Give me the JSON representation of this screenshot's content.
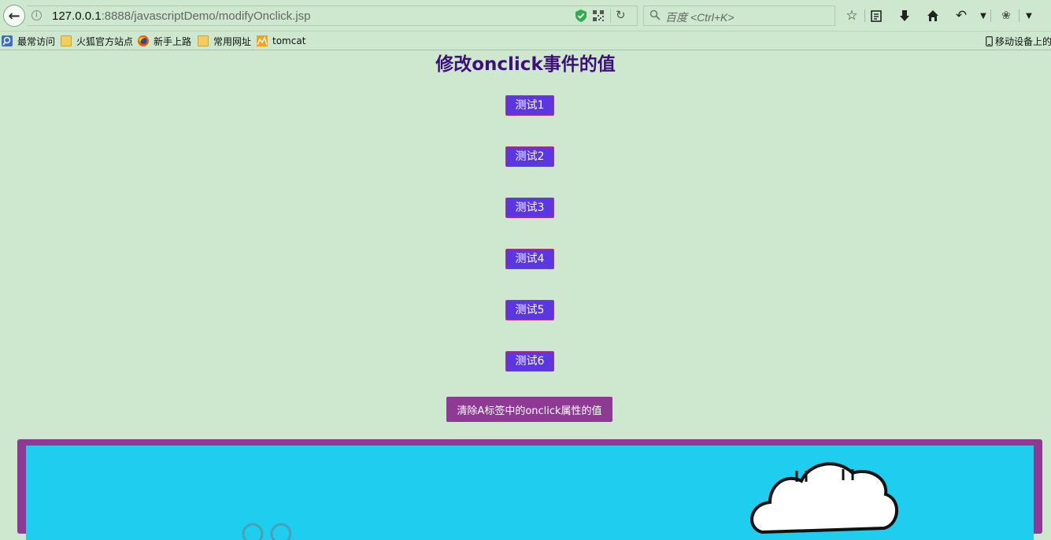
{
  "browser": {
    "url_host": "127.0.0.1",
    "url_path": ":8888/javascriptDemo/modifyOnclick.jsp",
    "search_placeholder": "百度 <Ctrl+K>"
  },
  "bookmarks": {
    "items": [
      {
        "label": "最常访问",
        "icon": "most-visited-icon"
      },
      {
        "label": "火狐官方站点",
        "icon": "folder-icon"
      },
      {
        "label": "新手上路",
        "icon": "firefox-icon"
      },
      {
        "label": "常用网址",
        "icon": "folder-icon"
      },
      {
        "label": "tomcat",
        "icon": "tomcat-icon"
      }
    ],
    "mobile_label": "移动设备上的"
  },
  "page": {
    "title": "修改onclick事件的值",
    "links": [
      "测试1",
      "测试2",
      "测试3",
      "测试4",
      "测试5",
      "测试6"
    ],
    "clear_button": "清除A标签中的onclick属性的值"
  },
  "colors": {
    "background": "#cde8cf",
    "title": "#3d0f7a",
    "link_bg": "#5a37e0",
    "link_border": "#c0306a",
    "button_bg": "#8e3a95",
    "image_bg": "#1fcdee"
  }
}
